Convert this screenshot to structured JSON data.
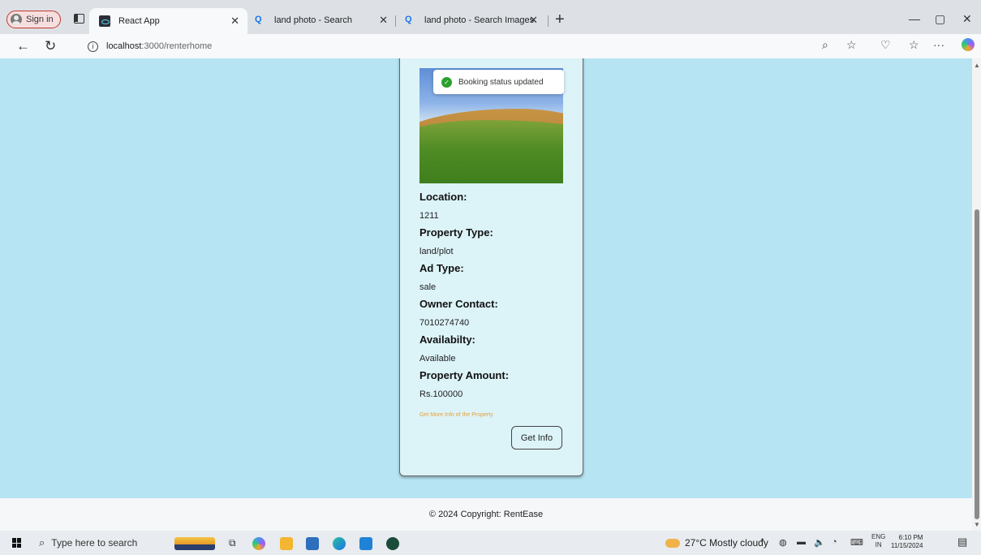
{
  "browser": {
    "signin_label": "Sign in",
    "tabs": [
      {
        "title": "React App"
      },
      {
        "title": "land photo - Search"
      },
      {
        "title": "land photo - Search Images"
      }
    ],
    "url_host": "localhost",
    "url_path": ":3000/renterhome"
  },
  "toast": {
    "message": "Booking status updated"
  },
  "property": {
    "location_label": "Location:",
    "location_value": "1211",
    "type_label": "Property Type:",
    "type_value": "land/plot",
    "ad_label": "Ad Type:",
    "ad_value": "sale",
    "contact_label": "Owner Contact:",
    "contact_value": "7010274740",
    "availability_label": "Availabilty:",
    "availability_value": "Available",
    "amount_label": "Property Amount:",
    "amount_value": "Rs.100000",
    "more_info_text": "Get More Info of the Property",
    "get_info_button": "Get Info"
  },
  "footer": {
    "copyright": "© 2024 Copyright: RentEase"
  },
  "taskbar": {
    "search_placeholder": "Type here to search",
    "weather": "27°C  Mostly cloudy",
    "lang_top": "ENG",
    "lang_bottom": "IN",
    "time": "6:10 PM",
    "date": "11/15/2024"
  }
}
